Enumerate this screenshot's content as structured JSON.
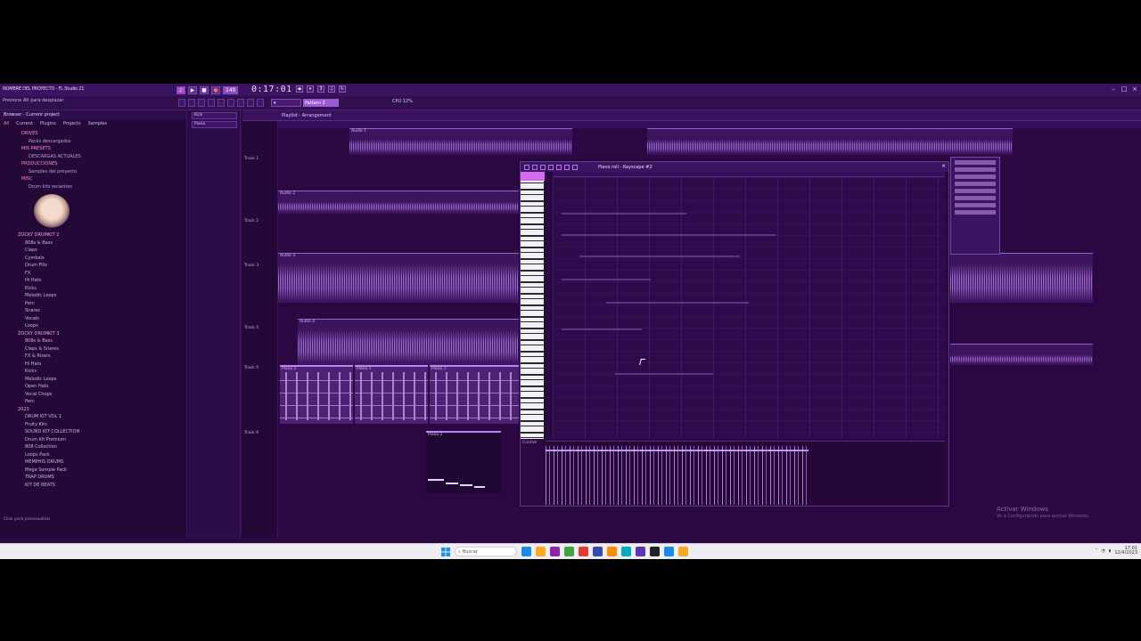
{
  "window": {
    "title": "NOMBRE DEL PROYECTO - FL Studio 21",
    "time": "0:17:01",
    "bpm": "140",
    "pattern": "Pattern 2",
    "toolbar_hint": "Presione Alt para desplazar",
    "cpu": "CPU 12%"
  },
  "browser": {
    "header": "Browser - Current project",
    "tabs": [
      "All",
      "Current",
      "Plugins",
      "Projects",
      "Samples"
    ],
    "top_items": [
      {
        "label": "DRIVES",
        "kind": "folder"
      },
      {
        "label": "Packs descargados",
        "kind": "sub"
      },
      {
        "label": "MIS PRESETS",
        "kind": "folder"
      },
      {
        "label": "DESCARGAS ACTUALES",
        "kind": "sub"
      },
      {
        "label": "PRODUCCIONES",
        "kind": "folder"
      },
      {
        "label": "Samples del proyecto",
        "kind": "sub"
      },
      {
        "label": "MISC",
        "kind": "folder"
      },
      {
        "label": "Drum kits recientes",
        "kind": "sub"
      }
    ],
    "section_1": "ZOCKY DRUMKIT 2",
    "section_1_items": [
      "808s & Bass",
      "Claps",
      "Cymbals",
      "Drum Fills",
      "FX",
      "Hi Hats",
      "Kicks",
      "Melodic Loops",
      "Perc",
      "Snares",
      "Vocals",
      "Loops"
    ],
    "section_2": "ZOCKY DRUMKIT 3",
    "section_2_items": [
      "808s & Bass",
      "Claps & Snares",
      "FX & Risers",
      "Hi Hats",
      "Kicks",
      "Melodic Loops",
      "Open Hats",
      "Vocal Chops",
      "Perc"
    ],
    "section_3": "2023",
    "section_3_items": [
      "DRUM KIT VOL 1",
      "Fruity Kits",
      "SOUND KIT COLLECTION",
      "Drum Kit Premium",
      "808 Collection",
      "Loops Pack",
      "MEMPHIS DRUMS",
      "Mega Sample Pack",
      "TRAP DRUMS",
      "KIT DE BEATS"
    ],
    "status": "Click para previsualizar"
  },
  "channels": [
    "Kick",
    "Piano"
  ],
  "playlist": {
    "header": "Playlist - Arrangement",
    "tracks": [
      {
        "label": "Track 1"
      },
      {
        "label": "Track 2"
      },
      {
        "label": "Track 3"
      },
      {
        "label": "Track 4"
      },
      {
        "label": "Track 5"
      },
      {
        "label": "Track 6"
      }
    ],
    "clips": [
      {
        "label": "Audio 1"
      },
      {
        "label": "Audio 2"
      },
      {
        "label": "Audio 3"
      },
      {
        "label": "Audio 4"
      },
      {
        "label": "Piano 1"
      },
      {
        "label": "Piano 1"
      },
      {
        "label": "Piano 1"
      },
      {
        "label": "Piano 2"
      }
    ]
  },
  "piano_roll": {
    "title": "Piano roll - Keyscape #2",
    "event_label": "Control"
  },
  "watermark": {
    "title": "Activar Windows",
    "subtitle": "Ve a Configuración para activar Windows."
  },
  "taskbar": {
    "search_placeholder": "Buscar",
    "time": "17:01",
    "date": "12/4/2023",
    "app_colors": [
      "#1e88e5",
      "#f9a825",
      "#8e24aa",
      "#43a047",
      "#e53935",
      "#3949ab",
      "#fb8c00",
      "#00acc1",
      "#5e35b1",
      "#212121"
    ]
  },
  "colors": {
    "accent": "#b04ad0",
    "playlist_bg": "#2a0943",
    "waveform": "#b07ae6"
  }
}
